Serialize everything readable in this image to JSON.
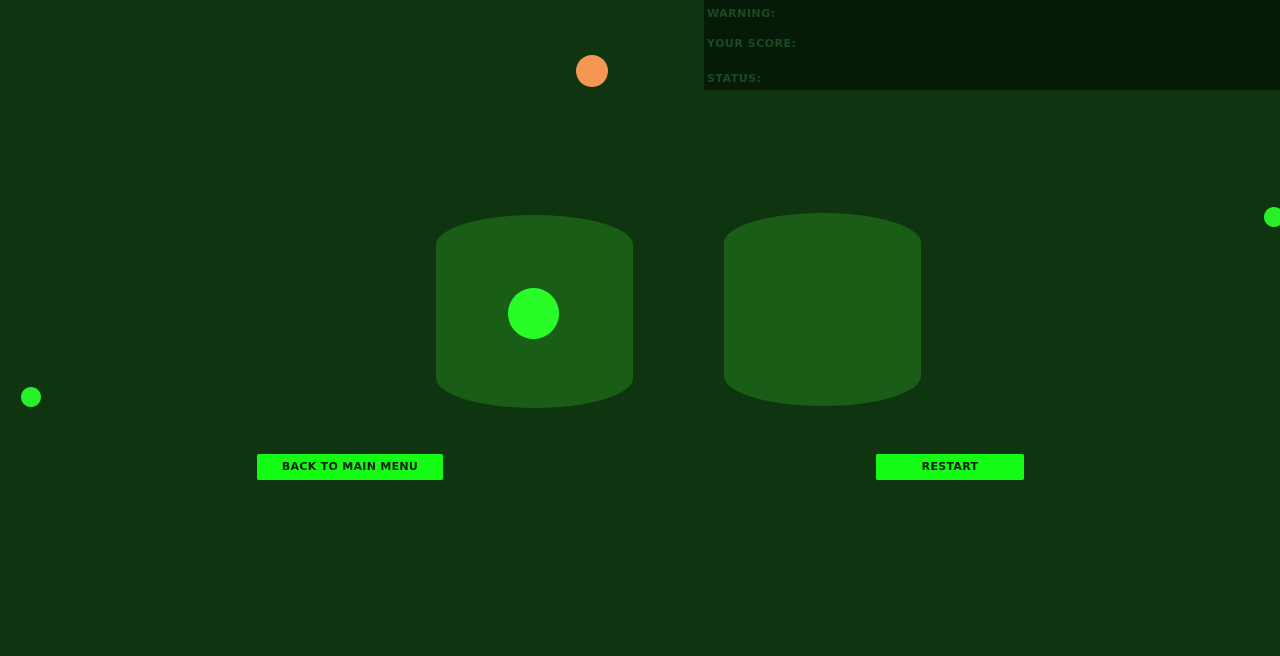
{
  "hud": {
    "warning_label": "WARNING:",
    "score_label": "YOUR SCORE:",
    "status_label": "STATUS:"
  },
  "buttons": {
    "back_to_menu": "BACK TO MAIN MENU",
    "restart": "RESTART"
  },
  "colors": {
    "background": "#0e3410",
    "hud_background": "#061a08",
    "hud_text": "#1d4a22",
    "cup": "#1a5d16",
    "ball_green": "#28fd28",
    "ball_orange": "#f59753",
    "button": "#14fc14",
    "button_text": "#062006"
  },
  "cups": [
    {
      "id": "left",
      "has_ball": true
    },
    {
      "id": "right",
      "has_ball": false
    }
  ]
}
